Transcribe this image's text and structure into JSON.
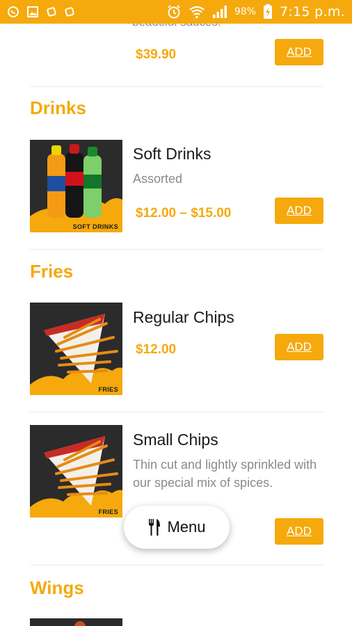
{
  "status_bar": {
    "battery": "98%",
    "time": "7:15 p.m.",
    "icons": [
      "whatsapp-icon",
      "gallery-icon",
      "app-icon",
      "app-icon",
      "alarm-icon",
      "wifi-icon",
      "signal-icon",
      "battery-charging-icon"
    ]
  },
  "colors": {
    "accent": "#f5a90c",
    "text": "#1a1a1a",
    "muted": "#8a8a8a"
  },
  "top_item": {
    "clipped_description": "beautiful sauces.",
    "price": "$39.90",
    "add_label": "ADD"
  },
  "sections": [
    {
      "title": "Drinks",
      "items": [
        {
          "name": "Soft Drinks",
          "description": "Assorted",
          "price": "$12.00 – $15.00",
          "add_label": "ADD",
          "thumb_caption": "SOFT DRINKS"
        }
      ]
    },
    {
      "title": "Fries",
      "items": [
        {
          "name": "Regular Chips",
          "description": "",
          "price": "$12.00",
          "add_label": "ADD",
          "thumb_caption": "FRIES"
        },
        {
          "name": "Small Chips",
          "description": "Thin cut and lightly sprinkled with our special mix of spices.",
          "price": "",
          "add_label": "ADD",
          "thumb_caption": "FRIES"
        }
      ]
    },
    {
      "title": "Wings",
      "items": []
    }
  ],
  "menu_button": {
    "label": "Menu",
    "icon": "cutlery-icon"
  }
}
